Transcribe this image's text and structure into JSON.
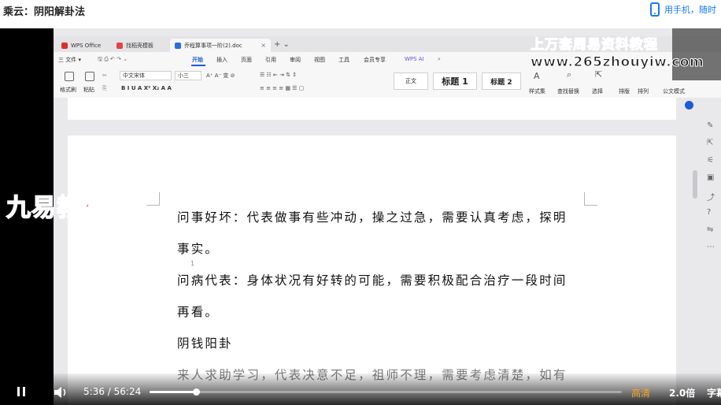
{
  "header": {
    "title": "乘云：阴阳解卦法",
    "mobile_link": "用手机，随时"
  },
  "wps": {
    "tabs": [
      {
        "label": "WPS Office",
        "color": "#d9302b"
      },
      {
        "label": "找稻壳模板",
        "color": "#e04444"
      },
      {
        "label": "乔程算事项一阶(2).doc",
        "color": "#2b6de3"
      }
    ],
    "menu": [
      "三 文件 ▾",
      "开始",
      "插入",
      "页面",
      "引用",
      "审阅",
      "视图",
      "工具",
      "会员专享",
      "WPS AI"
    ],
    "active_menu": "开始",
    "ribbon": {
      "format_painter": "格式刷",
      "paste": "粘贴",
      "font_name": "中文宋体",
      "font_size": "小三",
      "style_body": "正文",
      "style_h1": "标题 1",
      "style_h2": "标题 2",
      "styles_label": "样式集",
      "find_replace": "查找替换",
      "select": "选择",
      "sort": "排版",
      "arrange": "排列",
      "official_doc": "公文模式"
    }
  },
  "document": {
    "lines": [
      "问事好坏：代表做事有些冲动，操之过急，需要认真考虑，探明",
      "事实。",
      "问病代表：身体状况有好转的可能，需要积极配合治疗一段时间",
      "再看。",
      "阴钱阳卦",
      "来人求助学习，代表决意不足，祖师不理，需要考虑清楚，如有"
    ],
    "page_number": "1"
  },
  "watermarks": {
    "site_title": "上万套周易资料教程",
    "site_url": "www.265zhouyiw.com",
    "channel": "九易教程"
  },
  "player": {
    "current_time": "5:36",
    "separator": "/",
    "duration": "56:24",
    "progress": 0.099,
    "quality": "高清",
    "speed": "2.0倍",
    "subtitles": "字幕"
  },
  "colors": {
    "accent_blue": "#1677ff",
    "quality_orange": "#f5a623",
    "watermark_red": "#dd2222"
  }
}
